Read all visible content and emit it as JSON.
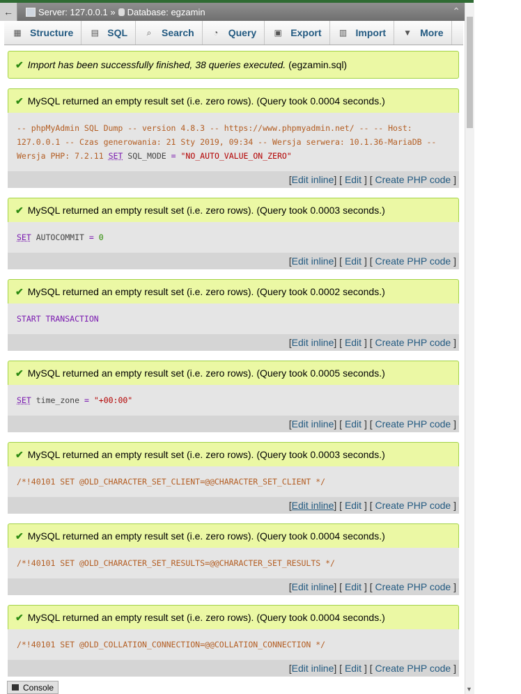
{
  "server_bar": {
    "back_label": "←",
    "server": "Server: 127.0.0.1 »",
    "database": "Database: egzamin",
    "collapse_glyph": "⌃"
  },
  "tabs": [
    {
      "label": "Structure",
      "icon": "structure-icon"
    },
    {
      "label": "SQL",
      "icon": "sql-icon"
    },
    {
      "label": "Search",
      "icon": "search-icon"
    },
    {
      "label": "Query",
      "icon": "query-icon"
    },
    {
      "label": "Export",
      "icon": "export-icon"
    },
    {
      "label": "Import",
      "icon": "import-icon"
    },
    {
      "label": "More",
      "icon": "chevron-down-icon"
    }
  ],
  "import_notice": "Import has been successfully finished, 38 queries executed.",
  "import_file": "(egzamin.sql)",
  "result_messages": [
    "MySQL returned an empty result set (i.e. zero rows). (Query took 0.0004 seconds.)",
    "MySQL returned an empty result set (i.e. zero rows). (Query took 0.0003 seconds.)",
    "MySQL returned an empty result set (i.e. zero rows). (Query took 0.0002 seconds.)",
    "MySQL returned an empty result set (i.e. zero rows). (Query took 0.0005 seconds.)",
    "MySQL returned an empty result set (i.e. zero rows). (Query took 0.0003 seconds.)",
    "MySQL returned an empty result set (i.e. zero rows). (Query took 0.0004 seconds.)",
    "MySQL returned an empty result set (i.e. zero rows). (Query took 0.0004 seconds.)"
  ],
  "sql": {
    "q1_comment": "-- phpMyAdmin SQL Dump -- version 4.8.3 -- https://www.phpmyadmin.net/ -- -- Host: 127.0.0.1 -- Czas generowania: 21 Sty 2019, 09:34 -- Wersja serwera: 10.1.36-MariaDB -- Wersja PHP: 7.2.11",
    "q1_set": "SET",
    "q1_var": "SQL_MODE",
    "q1_eq": "=",
    "q1_val": "\"NO_AUTO_VALUE_ON_ZERO\"",
    "q2_set": "SET",
    "q2_var": "AUTOCOMMIT",
    "q2_eq": "=",
    "q2_val": "0",
    "q3": "START TRANSACTION",
    "q4_set": "SET",
    "q4_var": "time_zone",
    "q4_eq": "=",
    "q4_val": "\"+00:00\"",
    "q5": "/*!40101 SET @OLD_CHARACTER_SET_CLIENT=@@CHARACTER_SET_CLIENT */",
    "q6": "/*!40101 SET @OLD_CHARACTER_SET_RESULTS=@@CHARACTER_SET_RESULTS */",
    "q7": "/*!40101 SET @OLD_COLLATION_CONNECTION=@@COLLATION_CONNECTION */"
  },
  "links": {
    "edit_inline": "Edit inline",
    "edit": "Edit",
    "create_php": "Create PHP code"
  },
  "console_label": "Console",
  "colors": {
    "success_bg": "#ebf8a4",
    "success_border": "#a2d246",
    "link": "#235a81",
    "sql_bg": "#e5e5e5",
    "links_bg": "#d5d5d5"
  }
}
